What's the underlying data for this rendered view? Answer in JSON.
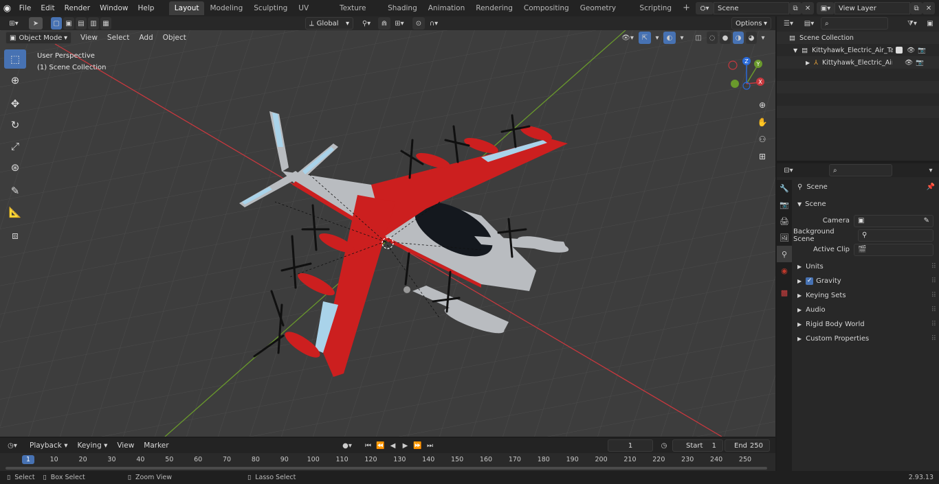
{
  "app": {
    "version": "2.93.13"
  },
  "topbar": {
    "menus": [
      "File",
      "Edit",
      "Render",
      "Window",
      "Help"
    ],
    "workspaces": [
      "Layout",
      "Modeling",
      "Sculpting",
      "UV Editing",
      "Texture Paint",
      "Shading",
      "Animation",
      "Rendering",
      "Compositing",
      "Geometry Nodes",
      "Scripting"
    ],
    "active_workspace": "Layout",
    "scene_name": "Scene",
    "view_layer": "View Layer"
  },
  "viewport": {
    "mode": "Object Mode",
    "menus": [
      "View",
      "Select",
      "Add",
      "Object"
    ],
    "orientation": "Global",
    "options_label": "Options",
    "overlay_line1": "User Perspective",
    "overlay_line2": "(1) Scene Collection",
    "gizmo": {
      "x": "X",
      "y": "Y",
      "z": "Z"
    }
  },
  "outliner": {
    "root": "Scene Collection",
    "items": [
      {
        "label": "Kittyhawk_Electric_Air_Taxi_R"
      },
      {
        "label": "Kittyhawk_Electric_Air_Ta"
      }
    ]
  },
  "properties": {
    "header": "Scene",
    "section": "Scene",
    "fields": [
      {
        "label": "Camera"
      },
      {
        "label": "Background Scene"
      },
      {
        "label": "Active Clip"
      }
    ],
    "panels": [
      "Units",
      "Gravity",
      "Keying Sets",
      "Audio",
      "Rigid Body World",
      "Custom Properties"
    ]
  },
  "timeline": {
    "menus": [
      "Playback",
      "Keying",
      "View",
      "Marker"
    ],
    "current_frame": "1",
    "start_label": "Start",
    "start": "1",
    "end_label": "End",
    "end": "250",
    "ticks": [
      "1",
      "10",
      "20",
      "30",
      "40",
      "50",
      "60",
      "70",
      "80",
      "90",
      "100",
      "110",
      "120",
      "130",
      "140",
      "150",
      "160",
      "170",
      "180",
      "190",
      "200",
      "210",
      "220",
      "230",
      "240",
      "250"
    ]
  },
  "statusbar": {
    "select": "Select",
    "box_select": "Box Select",
    "zoom_view": "Zoom View",
    "lasso_select": "Lasso Select"
  },
  "colors": {
    "accent": "#4772b3",
    "aircraft_red": "#cc1f1f",
    "aircraft_gray": "#b9bcc0",
    "aircraft_blue": "#a9d3ea",
    "axis_x": "#c8383e",
    "axis_y": "#6a9a2c"
  }
}
